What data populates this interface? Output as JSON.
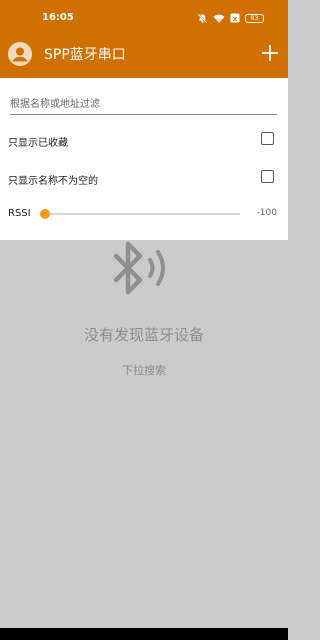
{
  "status_bar": {
    "time": "16:05",
    "icons": [
      "mute-icon",
      "wifi-icon",
      "notification-icon"
    ],
    "battery": "83"
  },
  "app_bar": {
    "title": "SPP蓝牙串口",
    "avatar_icon": "account-icon",
    "add_icon": "plus-icon",
    "background_color": "#d07000"
  },
  "filters": {
    "name_filter_placeholder": "根据名称或地址过滤",
    "name_filter_value": "",
    "only_favorites_label": "只显示已收藏",
    "only_favorites_checked": false,
    "only_named_label": "只显示名称不为空的",
    "only_named_checked": false,
    "rssi_label": "RSSI",
    "rssi_value": "-100",
    "rssi_slider_fraction": 0.0,
    "accent_color": "#f39a1f"
  },
  "empty_state": {
    "icon": "bluetooth-searching-icon",
    "title": "没有发现蓝牙设备",
    "hint": "下拉搜索"
  }
}
